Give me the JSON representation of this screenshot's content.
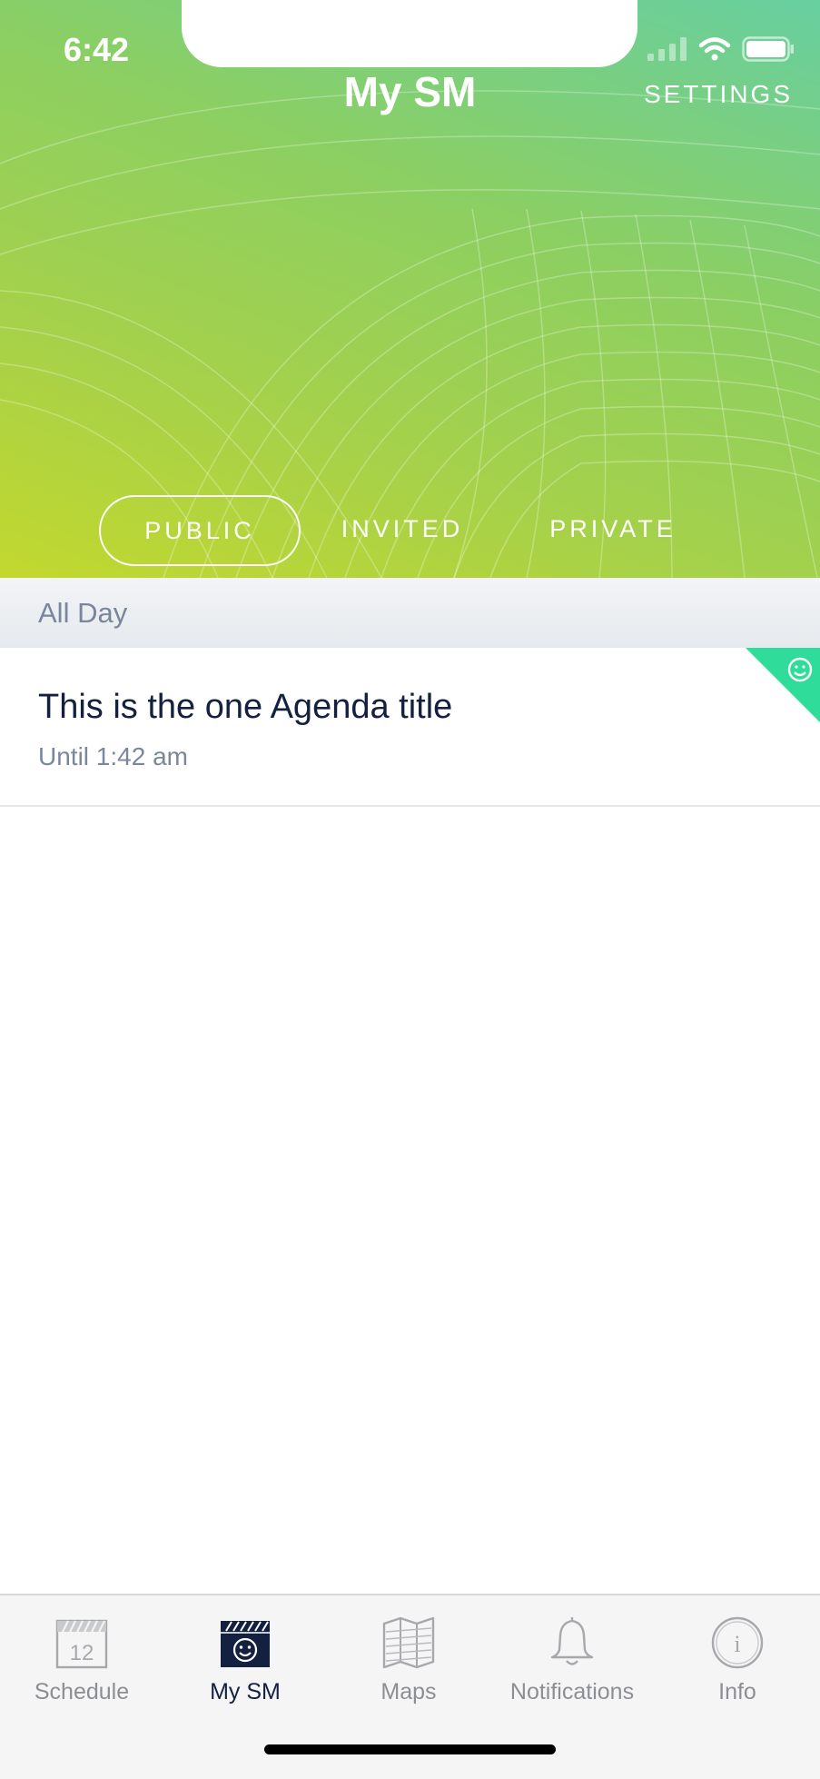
{
  "status_bar": {
    "time": "6:42"
  },
  "header": {
    "title": "My SM",
    "settings_label": "SETTINGS",
    "segments": [
      {
        "label": "PUBLIC",
        "active": true
      },
      {
        "label": "INVITED",
        "active": false
      },
      {
        "label": "PRIVATE",
        "active": false
      }
    ]
  },
  "section": {
    "label": "All Day"
  },
  "agenda": {
    "items": [
      {
        "title": "This is the one Agenda title",
        "subtitle": "Until 1:42 am",
        "badge_icon": "smiley-icon"
      }
    ]
  },
  "tab_bar": {
    "items": [
      {
        "label": "Schedule",
        "icon": "calendar-icon",
        "icon_text": "12",
        "active": false
      },
      {
        "label": "My SM",
        "icon": "smiley-calendar-icon",
        "active": true
      },
      {
        "label": "Maps",
        "icon": "map-icon",
        "active": false
      },
      {
        "label": "Notifications",
        "icon": "bell-icon",
        "active": false
      },
      {
        "label": "Info",
        "icon": "info-icon",
        "icon_text": "i",
        "active": false
      }
    ]
  },
  "colors": {
    "gradient_start": "#67cfa0",
    "gradient_end": "#c2d82e",
    "accent_badge": "#2fdc9a",
    "text_dark": "#14203f",
    "text_muted": "#7a869c",
    "tab_inactive": "#8d8e93"
  }
}
